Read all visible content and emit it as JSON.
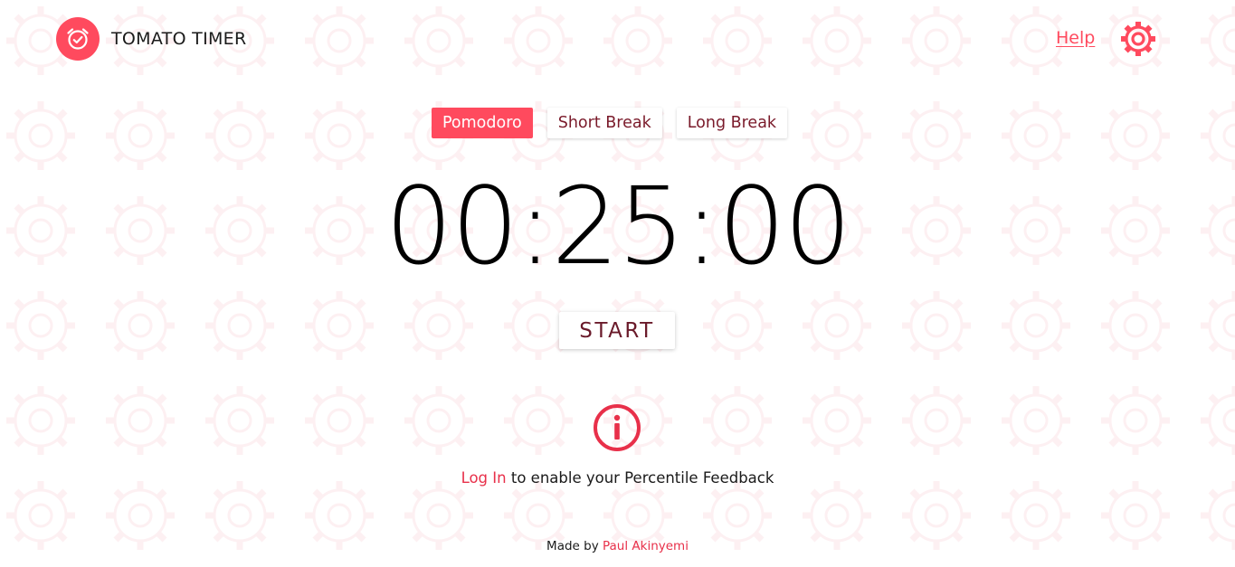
{
  "brand": {
    "name": "TOMATO TIMER",
    "logo_icon": "alarm-clock-check-icon"
  },
  "header": {
    "help_label": "Help",
    "settings_icon": "gear-icon"
  },
  "tabs": [
    {
      "label": "Pomodoro",
      "active": true
    },
    {
      "label": "Short Break",
      "active": false
    },
    {
      "label": "Long Break",
      "active": false
    }
  ],
  "timer": {
    "display": "00:25:00"
  },
  "controls": {
    "start_label": "START"
  },
  "info": {
    "icon": "info-circle-icon",
    "login_label": "Log In",
    "message": " to enable your Percentile Feedback"
  },
  "footer": {
    "prefix": "Made by ",
    "author": "Paul Akinyemi"
  },
  "colors": {
    "accent": "#ff4a5e",
    "link": "#e8304a",
    "tab_text": "#7a1a2a",
    "pattern": "#fbe6e9"
  }
}
